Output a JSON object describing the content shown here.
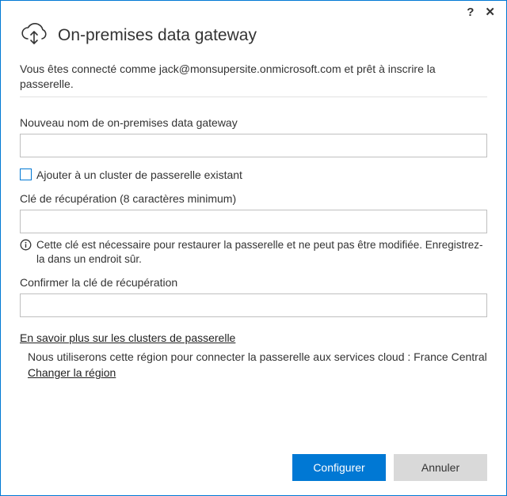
{
  "titlebar": {
    "help": "?",
    "close": "✕"
  },
  "header": {
    "title": "On-premises data gateway"
  },
  "intro": "Vous êtes connecté comme jack@monsupersite.onmicrosoft.com et prêt à inscrire la passerelle.",
  "form": {
    "name_label": "Nouveau nom de on-premises data gateway",
    "name_value": "",
    "cluster_checkbox_label": "Ajouter à un cluster de passerelle existant",
    "recovery_label": "Clé de récupération (8 caractères minimum)",
    "recovery_value": "",
    "recovery_info": "Cette clé est nécessaire pour restaurer la passerelle et ne peut pas être modifiée. Enregistrez-la dans un endroit sûr.",
    "confirm_label": "Confirmer la clé de récupération",
    "confirm_value": ""
  },
  "links": {
    "learn_more": "En savoir plus sur les clusters de passerelle",
    "region_text": "Nous utiliserons cette région pour connecter la passerelle aux services cloud : France Central",
    "change_region": "Changer la région"
  },
  "footer": {
    "configure": "Configurer",
    "cancel": "Annuler"
  }
}
